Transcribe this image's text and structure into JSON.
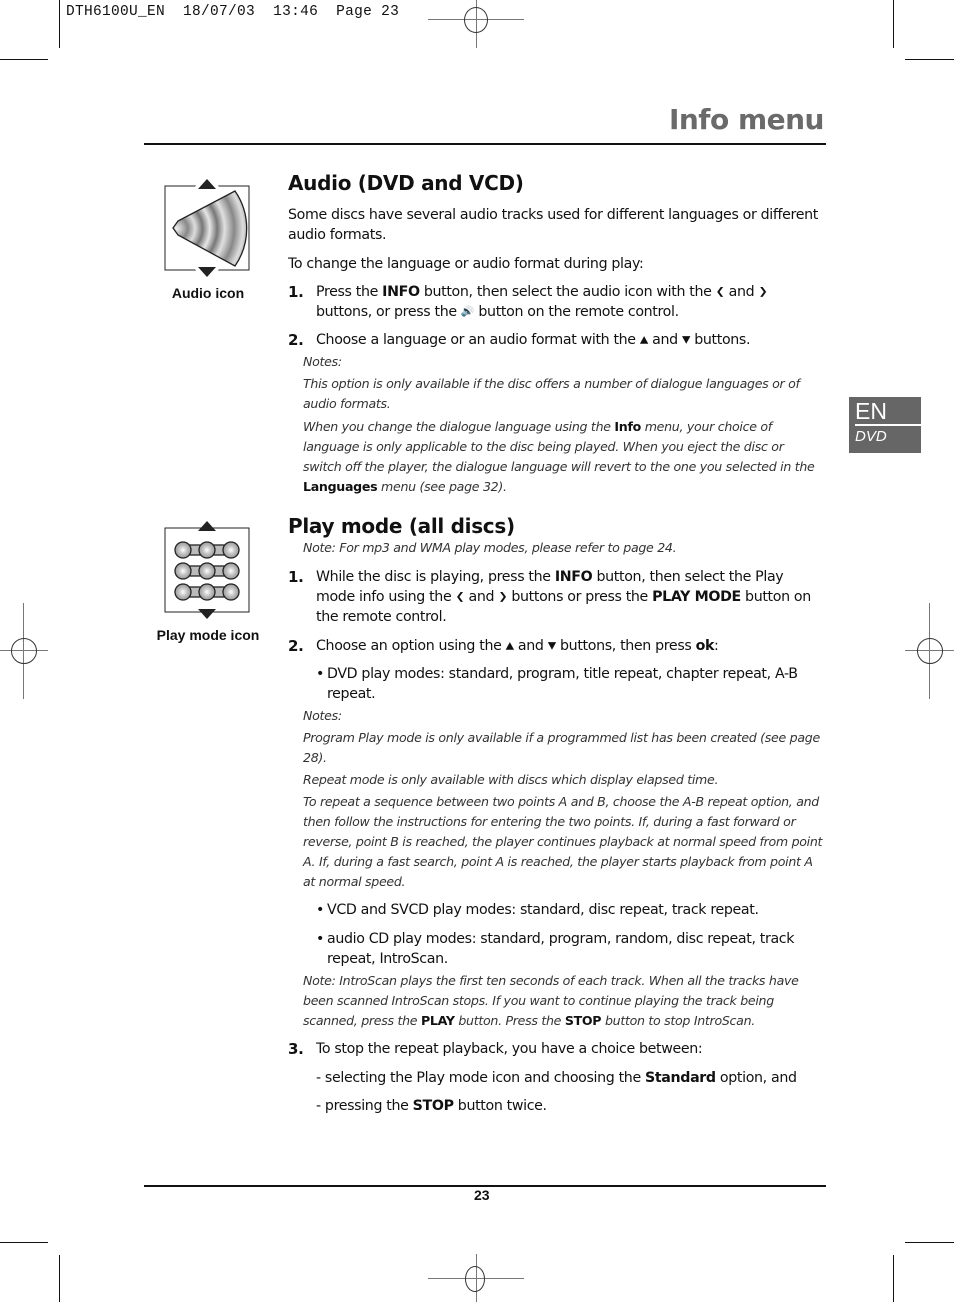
{
  "slug": {
    "doc_id": "DTH6100U_EN",
    "date": "18/07/03",
    "time": "13:46",
    "page_label": "Page 23"
  },
  "header": {
    "title": "Info menu"
  },
  "lang_tab": {
    "language": "EN",
    "section": "DVD"
  },
  "icons": {
    "left_arrow": "❮",
    "right_arrow": "❯",
    "up_arrow": "▲",
    "down_arrow": "▼",
    "audio_button": "🔊",
    "bullet": "•"
  },
  "audio": {
    "heading": "Audio (DVD and VCD)",
    "figure_caption": "Audio icon",
    "intro": "Some discs have several audio tracks used for different languages or different audio formats.",
    "lead": "To change the language or audio format during play:",
    "steps": [
      {
        "num": "1.",
        "a": "Press the ",
        "b_bold": "INFO",
        "c": " button, then select the audio icon with the ",
        "d": " and ",
        "e": " buttons, or press the ",
        "f": " button on the remote control."
      },
      {
        "num": "2.",
        "a": "Choose a language or an audio format with the ",
        "d": " and ",
        "f": " buttons."
      }
    ],
    "notes_label": "Notes:",
    "notes": [
      "This option is only available if the disc offers a number of dialogue languages or of audio formats.",
      {
        "a": "When you change the dialogue language using the ",
        "b_bold": "Info",
        "c": " menu, your choice of language is only applicable to the disc being played. When you eject the disc or switch off the player, the dialogue language will revert to the one you selected in the ",
        "d_bold": "Languages",
        "e": " menu (see page 32)."
      }
    ]
  },
  "play_mode": {
    "heading": "Play mode (all discs)",
    "figure_caption": "Play mode icon",
    "top_note": "Note: For mp3 and WMA play modes, please refer to page 24.",
    "step1": {
      "num": "1.",
      "a": "While the disc is playing, press the ",
      "b_bold": "INFO",
      "c": " button, then select the Play mode info using the ",
      "d": " and ",
      "e": " buttons or press the ",
      "f_bold": "PLAY MODE",
      "g": " button on the remote control."
    },
    "step2": {
      "num": "2.",
      "a": "Choose an option using the ",
      "d": " and ",
      "e": " buttons, then press ",
      "f_bold": "ok",
      "g": ":"
    },
    "dvd_modes": "DVD play modes: standard, program, title repeat, chapter repeat, A-B repeat.",
    "notes_label": "Notes:",
    "notes": [
      "Program Play mode is only available if a programmed list has been created (see page 28).",
      "Repeat mode is only available with discs which display elapsed time.",
      "To repeat a sequence between two points A and B, choose the A-B repeat option, and then follow the instructions for entering the two points. If, during a fast forward or reverse, point B is reached, the player continues playback at normal speed from point A. If, during a fast search, point A is reached, the player starts playback from point A at normal speed."
    ],
    "vcd_modes": "VCD and SVCD play modes: standard, disc repeat, track repeat.",
    "cd_modes": "audio CD play modes: standard, program, random, disc repeat, track repeat, IntroScan.",
    "introscan_note": {
      "a": "Note: IntroScan plays the first ten seconds of each track. When all the tracks have been scanned IntroScan stops. If you want to continue playing the track being scanned, press the ",
      "b_bold": "PLAY",
      "c": " button. Press the ",
      "d_bold": "STOP",
      "e": " button to stop IntroScan."
    },
    "step3": {
      "num": "3.",
      "text": "To stop the repeat playback, you have a choice between:",
      "option1": {
        "a": "- selecting the Play mode icon and choosing the ",
        "b_bold": "Standard",
        "c": " option, and"
      },
      "option2": {
        "a": "- pressing the ",
        "b_bold": "STOP",
        "c": " button twice."
      }
    }
  },
  "footer": {
    "page_number": "23"
  }
}
